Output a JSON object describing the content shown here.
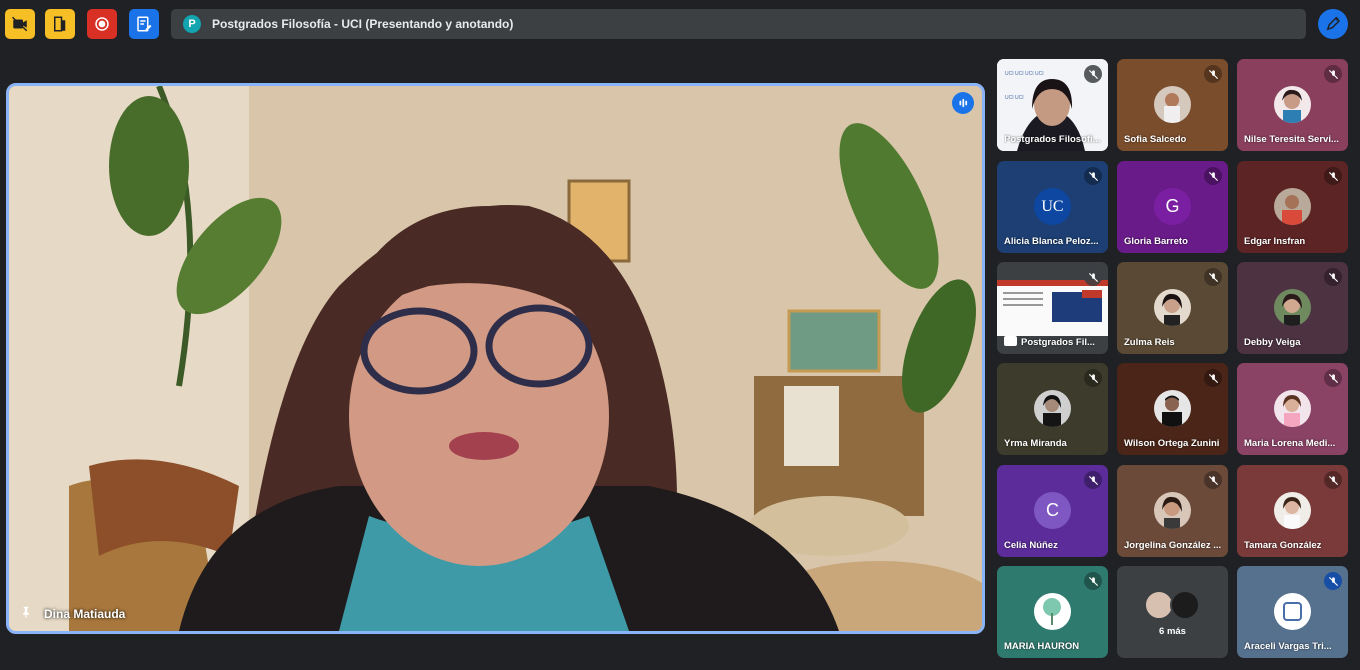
{
  "meeting": {
    "title": "Postgrados Filosofía - UCI (Presentando y anotando)",
    "avatar_letter": "P"
  },
  "colors": {
    "background": "#202124",
    "accent": "#1a73e8",
    "speaking_border": "#8ab4f8",
    "toolbar_yellow": "#f6bf26",
    "record_red": "#d93025"
  },
  "toolbar": {
    "icons": [
      "video-off-icon",
      "door-exit-icon",
      "record-icon",
      "notes-icon"
    ],
    "annotate_icon": "pen-icon"
  },
  "main_speaker": {
    "name": "Dina Matiauda",
    "pinned": true,
    "speaking": true
  },
  "participants": [
    {
      "name": "Postgrados Filosofí...",
      "muted": true
    },
    {
      "name": "Sofia Salcedo",
      "muted": true
    },
    {
      "name": "Nilse Teresita Servi...",
      "muted": true
    },
    {
      "name": "Alicia Blanca Peloz...",
      "muted": true
    },
    {
      "name": "Gloria Barreto",
      "muted": true,
      "letter": "G"
    },
    {
      "name": "Edgar Insfran",
      "muted": true
    },
    {
      "name": "Postgrados Fil...",
      "muted": true,
      "presenting": true
    },
    {
      "name": "Zulma Reis",
      "muted": true
    },
    {
      "name": "Debby Veiga",
      "muted": true
    },
    {
      "name": "Yrma Miranda",
      "muted": true
    },
    {
      "name": "Wilson Ortega Zunini",
      "muted": true
    },
    {
      "name": "Maria Lorena Medi...",
      "muted": true
    },
    {
      "name": "Celia Núñez",
      "muted": true,
      "letter": "C"
    },
    {
      "name": "Jorgelina González ...",
      "muted": true
    },
    {
      "name": "Tamara González",
      "muted": true
    },
    {
      "name": "MARIA HAURON",
      "muted": true
    },
    {
      "name": "6 más",
      "muted": false
    },
    {
      "name": "Araceli Vargas Tri...",
      "muted": true
    }
  ]
}
